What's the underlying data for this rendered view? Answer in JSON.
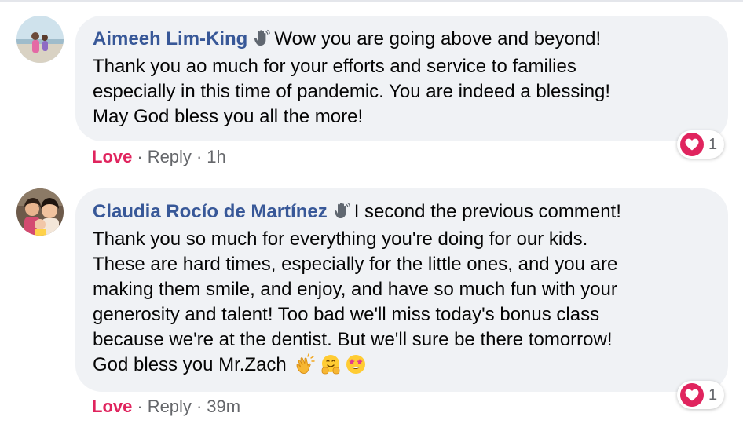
{
  "comments": [
    {
      "author": "Aimeeh Lim-King",
      "badge_icon": "wave-hand-icon",
      "lines": [
        "Wow you are going above and beyond!",
        "Thank you ao much for your efforts and service to families",
        "especially in this time of pandemic. You are indeed a blessing!",
        "May God bless you all the more!"
      ],
      "actions": {
        "love": "Love",
        "reply": "Reply",
        "time": "1h"
      },
      "reaction": {
        "icon": "heart-icon",
        "count": "1"
      }
    },
    {
      "author": "Claudia Rocío de Martínez",
      "badge_icon": "wave-hand-icon",
      "lines": [
        "I second the previous comment!",
        "Thank you so much for everything you're doing for our kids.",
        "These are hard times, especially for the little ones, and you are",
        "making them smile, and enjoy, and have so much fun with your",
        "generosity and talent! Too bad we'll miss today's bonus class",
        "because we're at the dentist. But we'll sure be there tomorrow!",
        "God bless you Mr.Zach"
      ],
      "emojis": [
        "clapping-hands-icon",
        "hugging-face-icon",
        "star-struck-icon"
      ],
      "actions": {
        "love": "Love",
        "reply": "Reply",
        "time": "39m"
      },
      "reaction": {
        "icon": "heart-icon",
        "count": "1"
      }
    }
  ],
  "colors": {
    "author": "#385898",
    "love": "#e0245e",
    "bubble": "#f0f2f5",
    "meta": "#65676b"
  }
}
